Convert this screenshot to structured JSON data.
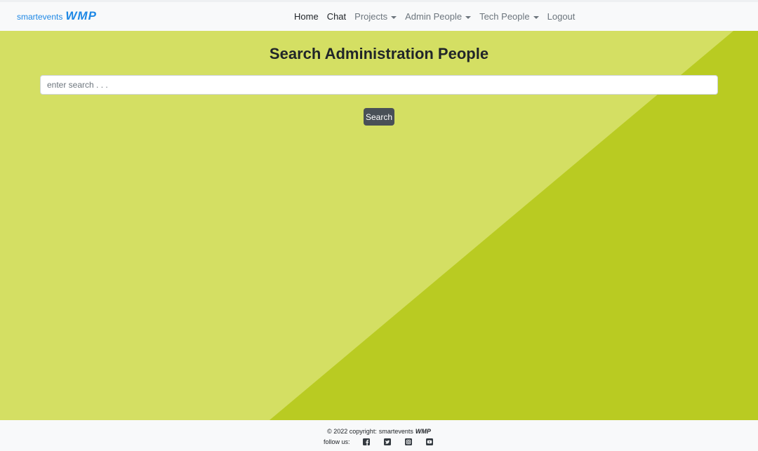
{
  "brand": {
    "small": "smartevents",
    "big": "WMP"
  },
  "nav": {
    "items": [
      {
        "label": "Home"
      },
      {
        "label": "Chat"
      },
      {
        "label": "Projects"
      },
      {
        "label": "Admin People"
      },
      {
        "label": "Tech People"
      },
      {
        "label": "Logout"
      }
    ]
  },
  "main": {
    "title": "Search Administration People",
    "search_placeholder": "enter search . . .",
    "search_value": "",
    "search_button": "Search"
  },
  "footer": {
    "copyright_prefix": "© 2022 copyright:",
    "brand_small": "smartevents",
    "brand_big": "WMP",
    "follow_label": "follow us:",
    "social_icons": [
      "facebook-icon",
      "twitter-icon",
      "instagram-icon",
      "youtube-icon"
    ]
  },
  "colors": {
    "background_light": "#d4df63",
    "background_dark": "#b9cb22",
    "brand": "#1e88e5",
    "button": "#495057",
    "navbar": "#f8f9fa"
  }
}
